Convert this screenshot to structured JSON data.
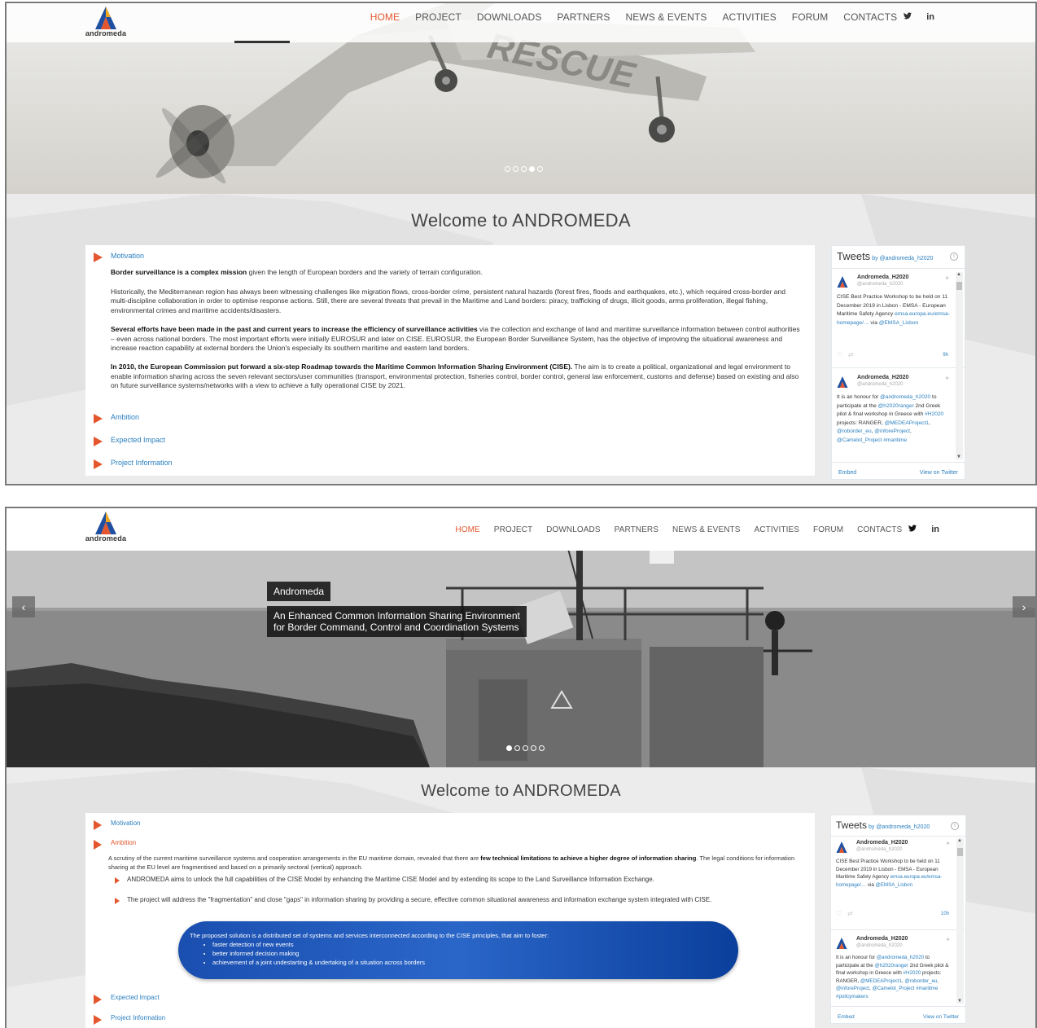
{
  "brand": {
    "name": "andromeda",
    "accent": "#e4572e",
    "link": "#2a7fbf"
  },
  "nav": {
    "items": [
      "HOME",
      "PROJECT",
      "DOWNLOADS",
      "PARTNERS",
      "NEWS & EVENTS",
      "ACTIVITIES",
      "FORUM",
      "CONTACTS"
    ],
    "active": "HOME",
    "social": [
      "twitter-icon",
      "linkedin-icon"
    ],
    "linkedin_label": "in",
    "twitter_glyph": "❚"
  },
  "welcome": "Welcome to ANDROMEDA",
  "hero1": {
    "tail_text": "RESCUE"
  },
  "hero2": {
    "caption_title": "Andromeda",
    "caption_line1": "An Enhanced Common Information Sharing Environment",
    "caption_line2": "for Border Command, Control and Coordination Systems",
    "prev": "‹",
    "next": "›"
  },
  "accordion": {
    "motivation": "Motivation",
    "ambition": "Ambition",
    "expected_impact": "Expected Impact",
    "project_information": "Project Information"
  },
  "motivation": {
    "p1_bold": "Border surveillance is a complex mission",
    "p1_rest": " given the length of European borders and the variety of terrain configuration.",
    "p2": "Historically, the Mediterranean region has always been witnessing challenges like migration flows, cross-border crime, persistent natural hazards (forest fires, floods and earthquakes, etc.), which required cross-border and multi-discipline collaboration in order to optimise response actions. Still, there are several threats that prevail in the Maritime and Land borders: piracy, trafficking of drugs, illicit goods, arms proliferation, illegal fishing, environmental crimes and maritime accidents/disasters.",
    "p3_bold": "Several efforts have been made in the past and current years to increase the efficiency of surveillance activities",
    "p3_rest": " via the collection and exchange of land and maritime surveillance information between control authorities – even across national borders. The most important efforts were initially EUROSUR and later on CISE. EUROSUR, the European Border Surveillance System, has the objective of improving the situational awareness and increase reaction capability at external borders the Union's especially its southern maritime and eastern land borders.",
    "p4_bold": "In 2010, the European Commission put forward a six-step Roadmap towards the Maritime Common Information Sharing Environment (CISE).",
    "p4_rest": " The aim is to create a political, organizational and legal environment to enable information sharing across the seven relevant sectors/user communities (transport, environmental protection, fisheries control, border control, general law enforcement, customs and defense) based on existing and also on future surveillance systems/networks with a view to achieve a fully operational CISE by 2021."
  },
  "ambition": {
    "intro": "A scrutiny of the current maritime surveillance systems and cooperation arrangements in the EU maritime domain, revealed that there are ",
    "intro_bold": "few technical limitations to achieve a higher degree of information sharing",
    "intro_rest": ". The legal conditions for information sharing at the EU level are fragmentised and based on a primarily sectoral (vertical) approach.",
    "bullet1": "ANDROMEDA aims to unlock the full capabilities of the CISE Model by enhancing the Maritime CISE Model and by extending its scope to the Land Surveillance Information Exchange.",
    "bullet2": "The project will address the \"fragmentation\" and close \"gaps\" in information sharing by providing a secure, effective common situational awareness and information exchange system integrated with CISE.",
    "solution_title": "The proposed solution is a distributed set of systems and services interconnected according to the CISE principles, that aim to foster:",
    "solution_items": [
      "faster detection of new events",
      "better informed decision making",
      "achievement of a joint undestarting & undertaking of a situation across borders"
    ]
  },
  "tweets": {
    "title": "Tweets",
    "by": "by ",
    "by_handle": "@andromeda_h2020",
    "embed": "Embed",
    "view": "View on Twitter",
    "info": "i",
    "reply_icon": "♡",
    "retweet_icon": "⇄",
    "items": [
      {
        "name": "Andromeda_H2020",
        "handle": "@andromeda_h2020",
        "text1": "CISE Best Practice Workshop to be held on 11 December 2019 in Lisbon - EMSA - European Maritime Safety Agency",
        "link": "emsa.europa.eu/emsa-homepage/…",
        "via": " via ",
        "mention": "@EMSA_Lisbon",
        "time1": "9h",
        "time2": "10h"
      },
      {
        "name": "Andromeda_H2020",
        "handle": "@andromeda_h2020",
        "t_a": "It is an honour for ",
        "m1": "@andromeda_h2020",
        "t_b": " to participate at the ",
        "m2": "@h2020ranger",
        "t_c": " 2nd Greek pilot & final workshop in Greece with ",
        "m3": "#H2020",
        "t_d": " projects: RANGER, ",
        "m4": "@MEDEAProject1",
        "t_e": ", ",
        "m5": "@roborder_eu",
        "t_f": ", ",
        "m6": "@inforeProject",
        "t_g": ", ",
        "m7": "@Camelot_Project",
        "m8": " #maritime",
        "m9": " #policymakers"
      }
    ]
  }
}
